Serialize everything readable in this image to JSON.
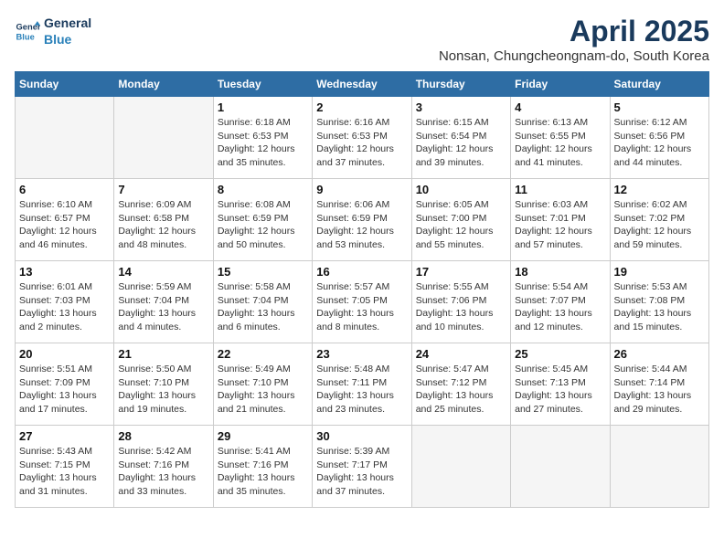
{
  "logo": {
    "line1": "General",
    "line2": "Blue"
  },
  "title": "April 2025",
  "subtitle": "Nonsan, Chungcheongnam-do, South Korea",
  "weekdays": [
    "Sunday",
    "Monday",
    "Tuesday",
    "Wednesday",
    "Thursday",
    "Friday",
    "Saturday"
  ],
  "weeks": [
    [
      {
        "num": "",
        "detail": ""
      },
      {
        "num": "",
        "detail": ""
      },
      {
        "num": "1",
        "detail": "Sunrise: 6:18 AM\nSunset: 6:53 PM\nDaylight: 12 hours and 35 minutes."
      },
      {
        "num": "2",
        "detail": "Sunrise: 6:16 AM\nSunset: 6:53 PM\nDaylight: 12 hours and 37 minutes."
      },
      {
        "num": "3",
        "detail": "Sunrise: 6:15 AM\nSunset: 6:54 PM\nDaylight: 12 hours and 39 minutes."
      },
      {
        "num": "4",
        "detail": "Sunrise: 6:13 AM\nSunset: 6:55 PM\nDaylight: 12 hours and 41 minutes."
      },
      {
        "num": "5",
        "detail": "Sunrise: 6:12 AM\nSunset: 6:56 PM\nDaylight: 12 hours and 44 minutes."
      }
    ],
    [
      {
        "num": "6",
        "detail": "Sunrise: 6:10 AM\nSunset: 6:57 PM\nDaylight: 12 hours and 46 minutes."
      },
      {
        "num": "7",
        "detail": "Sunrise: 6:09 AM\nSunset: 6:58 PM\nDaylight: 12 hours and 48 minutes."
      },
      {
        "num": "8",
        "detail": "Sunrise: 6:08 AM\nSunset: 6:59 PM\nDaylight: 12 hours and 50 minutes."
      },
      {
        "num": "9",
        "detail": "Sunrise: 6:06 AM\nSunset: 6:59 PM\nDaylight: 12 hours and 53 minutes."
      },
      {
        "num": "10",
        "detail": "Sunrise: 6:05 AM\nSunset: 7:00 PM\nDaylight: 12 hours and 55 minutes."
      },
      {
        "num": "11",
        "detail": "Sunrise: 6:03 AM\nSunset: 7:01 PM\nDaylight: 12 hours and 57 minutes."
      },
      {
        "num": "12",
        "detail": "Sunrise: 6:02 AM\nSunset: 7:02 PM\nDaylight: 12 hours and 59 minutes."
      }
    ],
    [
      {
        "num": "13",
        "detail": "Sunrise: 6:01 AM\nSunset: 7:03 PM\nDaylight: 13 hours and 2 minutes."
      },
      {
        "num": "14",
        "detail": "Sunrise: 5:59 AM\nSunset: 7:04 PM\nDaylight: 13 hours and 4 minutes."
      },
      {
        "num": "15",
        "detail": "Sunrise: 5:58 AM\nSunset: 7:04 PM\nDaylight: 13 hours and 6 minutes."
      },
      {
        "num": "16",
        "detail": "Sunrise: 5:57 AM\nSunset: 7:05 PM\nDaylight: 13 hours and 8 minutes."
      },
      {
        "num": "17",
        "detail": "Sunrise: 5:55 AM\nSunset: 7:06 PM\nDaylight: 13 hours and 10 minutes."
      },
      {
        "num": "18",
        "detail": "Sunrise: 5:54 AM\nSunset: 7:07 PM\nDaylight: 13 hours and 12 minutes."
      },
      {
        "num": "19",
        "detail": "Sunrise: 5:53 AM\nSunset: 7:08 PM\nDaylight: 13 hours and 15 minutes."
      }
    ],
    [
      {
        "num": "20",
        "detail": "Sunrise: 5:51 AM\nSunset: 7:09 PM\nDaylight: 13 hours and 17 minutes."
      },
      {
        "num": "21",
        "detail": "Sunrise: 5:50 AM\nSunset: 7:10 PM\nDaylight: 13 hours and 19 minutes."
      },
      {
        "num": "22",
        "detail": "Sunrise: 5:49 AM\nSunset: 7:10 PM\nDaylight: 13 hours and 21 minutes."
      },
      {
        "num": "23",
        "detail": "Sunrise: 5:48 AM\nSunset: 7:11 PM\nDaylight: 13 hours and 23 minutes."
      },
      {
        "num": "24",
        "detail": "Sunrise: 5:47 AM\nSunset: 7:12 PM\nDaylight: 13 hours and 25 minutes."
      },
      {
        "num": "25",
        "detail": "Sunrise: 5:45 AM\nSunset: 7:13 PM\nDaylight: 13 hours and 27 minutes."
      },
      {
        "num": "26",
        "detail": "Sunrise: 5:44 AM\nSunset: 7:14 PM\nDaylight: 13 hours and 29 minutes."
      }
    ],
    [
      {
        "num": "27",
        "detail": "Sunrise: 5:43 AM\nSunset: 7:15 PM\nDaylight: 13 hours and 31 minutes."
      },
      {
        "num": "28",
        "detail": "Sunrise: 5:42 AM\nSunset: 7:16 PM\nDaylight: 13 hours and 33 minutes."
      },
      {
        "num": "29",
        "detail": "Sunrise: 5:41 AM\nSunset: 7:16 PM\nDaylight: 13 hours and 35 minutes."
      },
      {
        "num": "30",
        "detail": "Sunrise: 5:39 AM\nSunset: 7:17 PM\nDaylight: 13 hours and 37 minutes."
      },
      {
        "num": "",
        "detail": ""
      },
      {
        "num": "",
        "detail": ""
      },
      {
        "num": "",
        "detail": ""
      }
    ]
  ]
}
